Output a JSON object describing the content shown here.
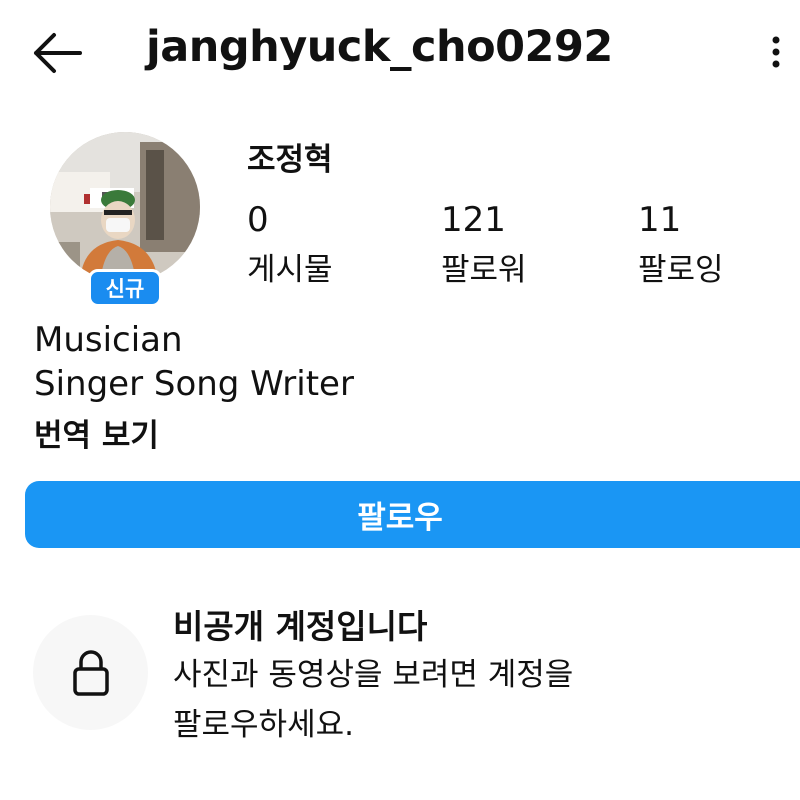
{
  "header": {
    "username": "janghyuck_cho0292",
    "back_icon": "back-arrow-icon",
    "more_icon": "more-vertical-icon"
  },
  "profile": {
    "display_name": "조정혁",
    "badge": "신규",
    "stats": [
      {
        "value": "0",
        "label": "게시물"
      },
      {
        "value": "121",
        "label": "팔로워"
      },
      {
        "value": "11",
        "label": "팔로잉"
      }
    ],
    "bio_lines": [
      "Musician",
      "Singer Song Writer"
    ],
    "translate_label": "번역 보기"
  },
  "actions": {
    "follow_label": "팔로우"
  },
  "private_notice": {
    "icon": "lock-icon",
    "title": "비공개 계정입니다",
    "desc_line1": "사진과 동영상을 보려면 계정을",
    "desc_line2": "팔로우하세요."
  },
  "colors": {
    "accent": "#1a96f4",
    "badge": "#1a8cf0",
    "text": "#111111"
  }
}
